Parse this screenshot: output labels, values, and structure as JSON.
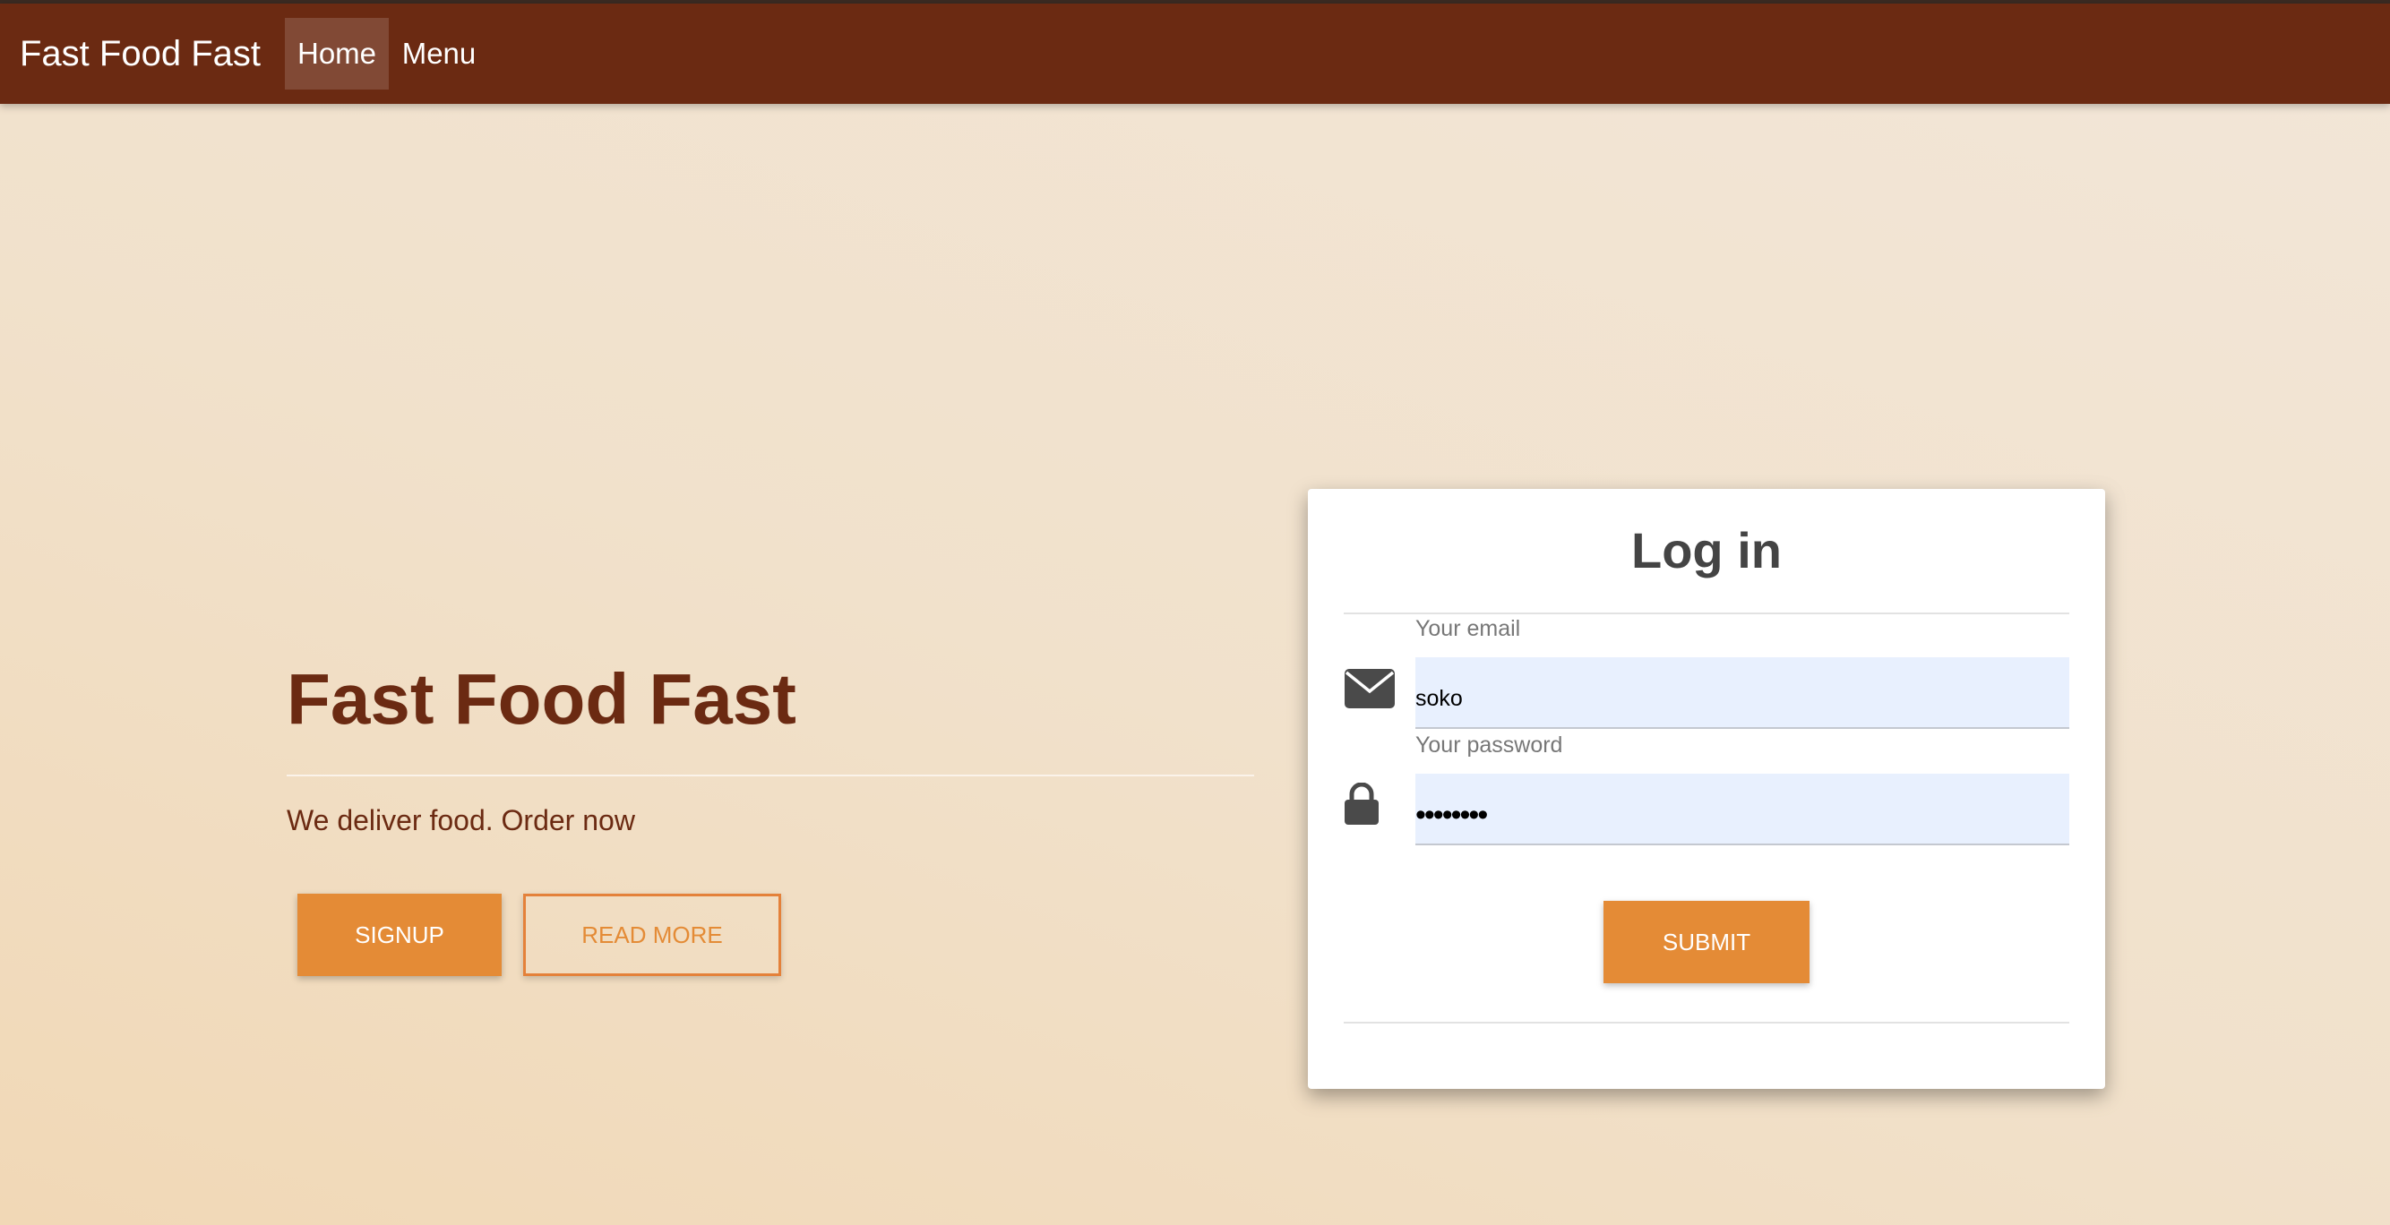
{
  "navbar": {
    "brand": "Fast Food Fast",
    "items": [
      {
        "label": "Home",
        "active": true
      },
      {
        "label": "Menu",
        "active": false
      }
    ],
    "background_color": "#6b2a12"
  },
  "hero": {
    "title": "Fast Food Fast",
    "subtitle": "We deliver food. Order now",
    "signup_label": "SIGNUP",
    "read_more_label": "READ MORE",
    "title_color": "#6b2a12",
    "accent_color": "#e48b36"
  },
  "login": {
    "title": "Log in",
    "email_label": "Your email",
    "email_value": "soko",
    "password_label": "Your password",
    "password_value": "••••••••",
    "submit_label": "SUBMIT",
    "email_icon": "envelope-icon",
    "password_icon": "lock-icon"
  }
}
